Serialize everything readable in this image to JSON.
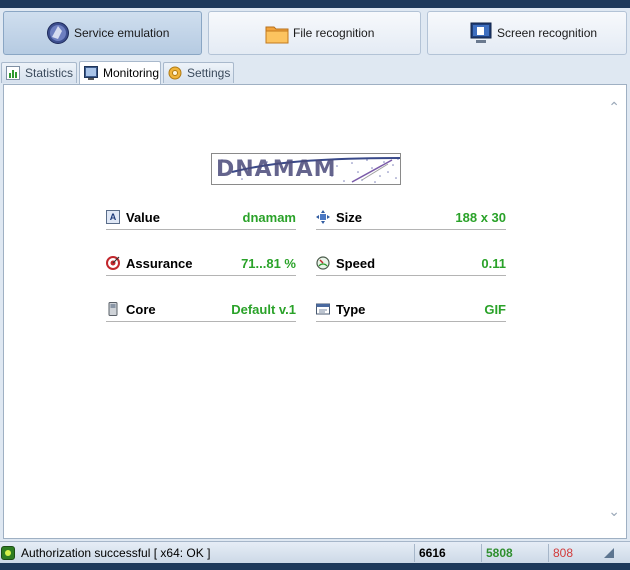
{
  "toolbar": {
    "service_emulation": "Service emulation",
    "file_recognition": "File recognition",
    "screen_recognition": "Screen recognition"
  },
  "tabs": [
    {
      "label": "Statistics",
      "icon": "bar-chart-icon"
    },
    {
      "label": "Monitoring",
      "icon": "monitor-icon",
      "active": true
    },
    {
      "label": "Settings",
      "icon": "gear-icon"
    }
  ],
  "captcha": {
    "text": "DNAMAM"
  },
  "details": {
    "value": {
      "label": "Value",
      "val": "dnamam"
    },
    "size": {
      "label": "Size",
      "val": "188 x 30"
    },
    "assurance": {
      "label": "Assurance",
      "val": "71...81 %"
    },
    "speed": {
      "label": "Speed",
      "val": "0.11"
    },
    "core": {
      "label": "Core",
      "val": "Default v.1"
    },
    "type": {
      "label": "Type",
      "val": "GIF"
    }
  },
  "status": {
    "message": "Authorization successful [ x64: OK ]",
    "count1": "6616",
    "count2": "5808",
    "count3": "808"
  },
  "colors": {
    "accent_green": "#2aa229",
    "error_red": "#d23a3a",
    "frame_dark": "#1e395b"
  }
}
